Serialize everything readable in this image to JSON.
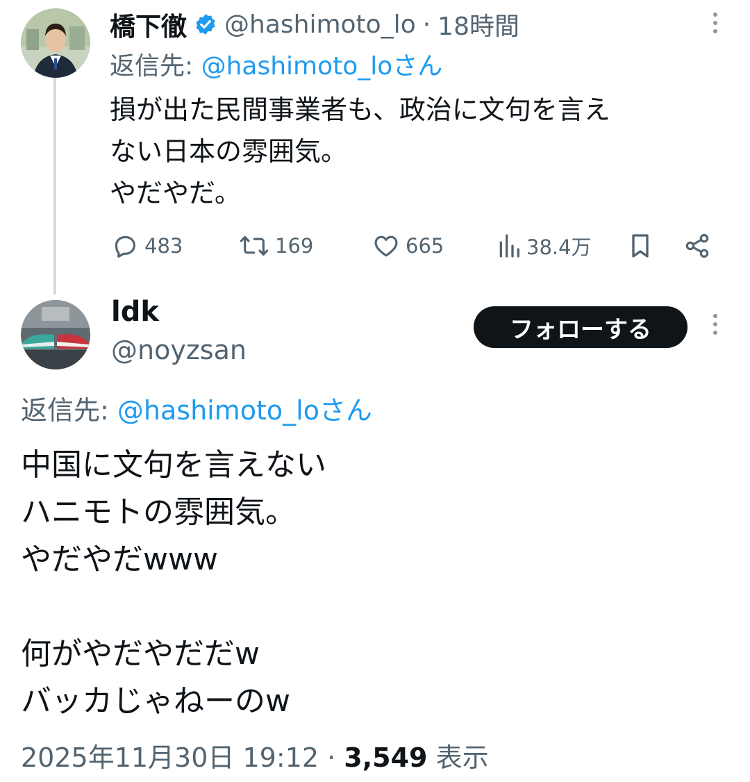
{
  "parent_tweet": {
    "author_name": "橋下徹",
    "verified": true,
    "handle": "@hashimoto_lo",
    "separator": "·",
    "time_ago": "18時間",
    "reply_to_label": "返信先:",
    "reply_to_handle": "@hashimoto_loさん",
    "body_lines": [
      "損が出た民間事業者も、政治に文句を言え",
      "ない日本の雰囲気。",
      "やだやだ。"
    ],
    "stats": {
      "replies": "483",
      "retweets": "169",
      "likes": "665",
      "views": "38.4万"
    }
  },
  "reply_tweet": {
    "author_name": "ldk",
    "handle": "@noyzsan",
    "follow_label": "フォローする",
    "reply_to_label": "返信先:",
    "reply_to_handle": "@hashimoto_loさん",
    "body_lines": [
      "中国に文句を言えない",
      "ハニモトの雰囲気。",
      "やだやだwww",
      "",
      "何がやだやだだw",
      "バッカじゃねーのw"
    ],
    "timestamp": "2025年11月30日 19:12",
    "separator": "·",
    "view_count": "3,549",
    "view_label": "表示"
  },
  "colors": {
    "text": "#0f1419",
    "secondary": "#536471",
    "accent": "#1d9bf0",
    "follow_bg": "#0f1419"
  },
  "icons": [
    "verified-badge-icon",
    "reply-icon",
    "retweet-icon",
    "like-icon",
    "views-icon",
    "bookmark-icon",
    "share-icon",
    "more-options-icon"
  ]
}
